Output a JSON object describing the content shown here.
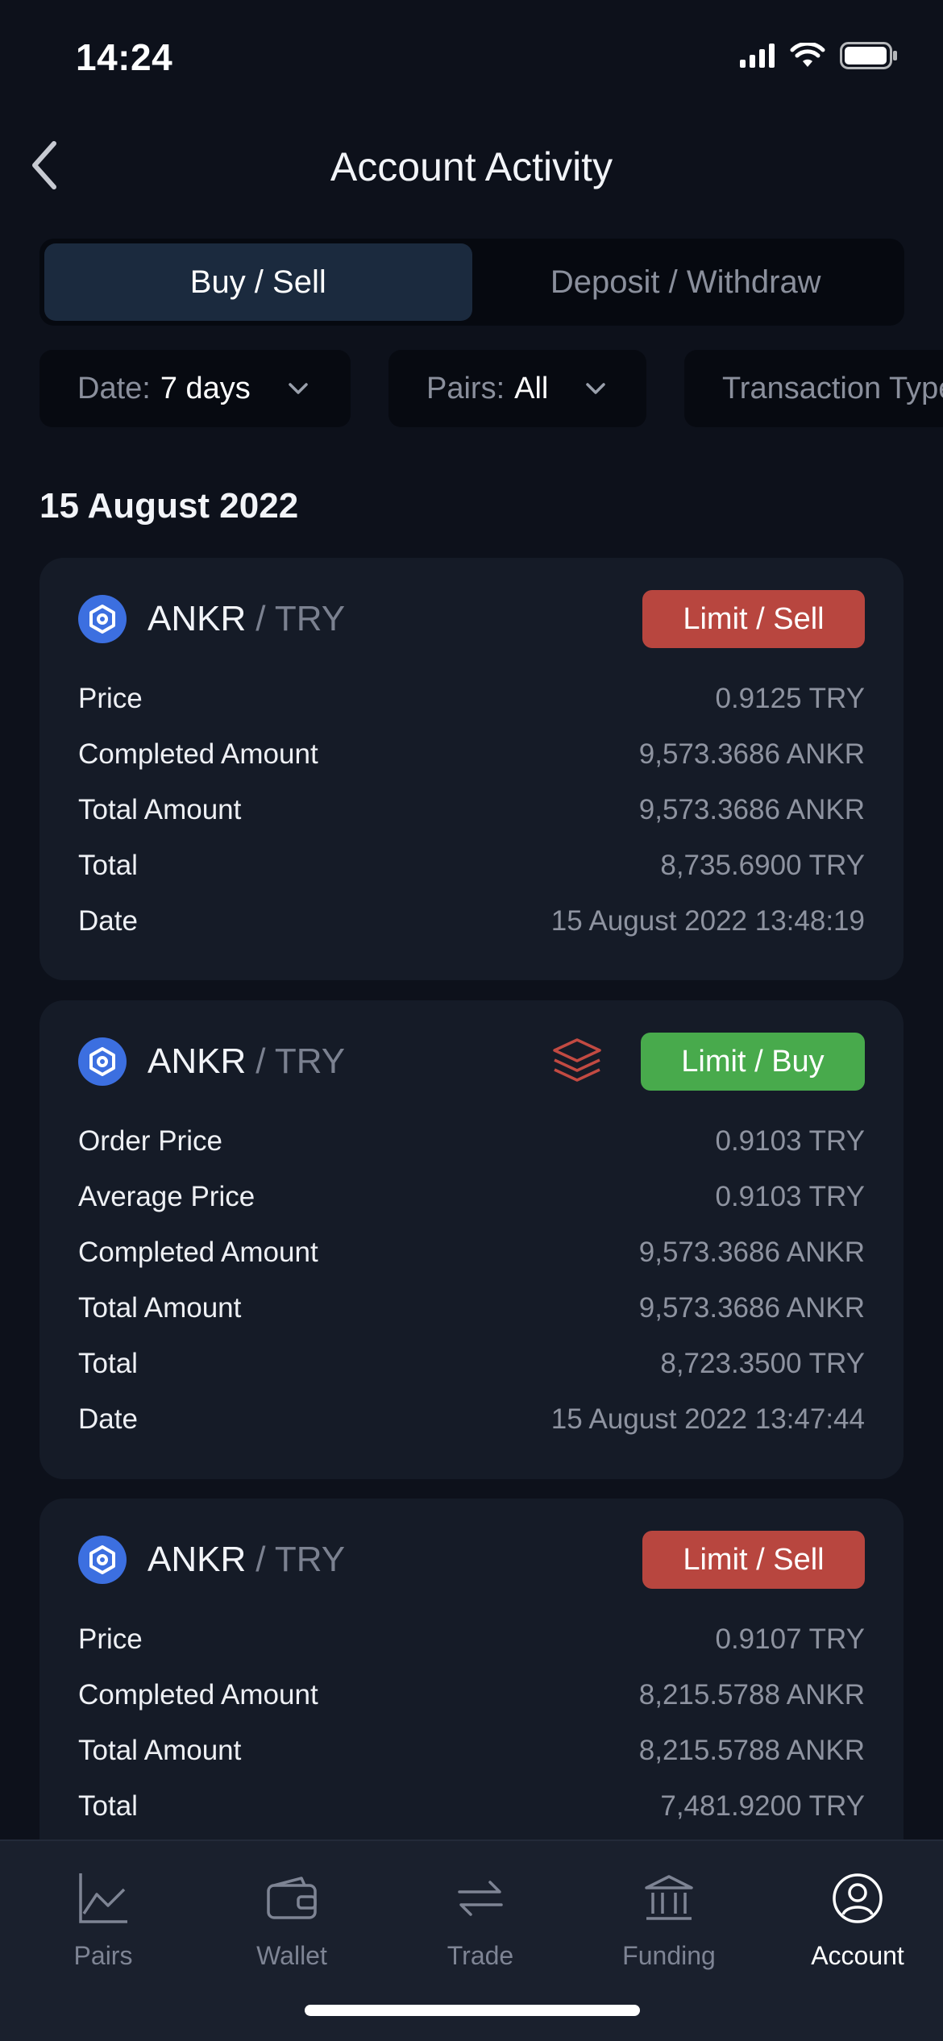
{
  "status_bar": {
    "time": "14:24"
  },
  "header": {
    "title": "Account Activity"
  },
  "segment": {
    "tabs": [
      "Buy / Sell",
      "Deposit / Withdraw"
    ],
    "active": 0
  },
  "filters": [
    {
      "label": "Date:",
      "value": "7 days"
    },
    {
      "label": "Pairs:",
      "value": "All"
    },
    {
      "label": "Transaction Type",
      "value": ""
    }
  ],
  "section": {
    "date": "15 August 2022"
  },
  "orders": [
    {
      "base": "ANKR",
      "quote": "/ TRY",
      "type": "Limit / Sell",
      "multi_fill": false,
      "rows": [
        {
          "k": "Price",
          "v": "0.9125 TRY"
        },
        {
          "k": "Completed Amount",
          "v": "9,573.3686 ANKR"
        },
        {
          "k": "Total Amount",
          "v": "9,573.3686 ANKR"
        },
        {
          "k": "Total",
          "v": "8,735.6900 TRY"
        },
        {
          "k": "Date",
          "v": "15 August 2022 13:48:19"
        }
      ]
    },
    {
      "base": "ANKR",
      "quote": "/ TRY",
      "type": "Limit / Buy",
      "multi_fill": true,
      "rows": [
        {
          "k": "Order Price",
          "v": "0.9103 TRY"
        },
        {
          "k": "Average Price",
          "v": "0.9103 TRY"
        },
        {
          "k": "Completed Amount",
          "v": "9,573.3686 ANKR"
        },
        {
          "k": "Total Amount",
          "v": "9,573.3686 ANKR"
        },
        {
          "k": "Total",
          "v": "8,723.3500 TRY"
        },
        {
          "k": "Date",
          "v": "15 August 2022 13:47:44"
        }
      ]
    },
    {
      "base": "ANKR",
      "quote": "/ TRY",
      "type": "Limit / Sell",
      "multi_fill": false,
      "rows": [
        {
          "k": "Price",
          "v": "0.9107 TRY"
        },
        {
          "k": "Completed Amount",
          "v": "8,215.5788 ANKR"
        },
        {
          "k": "Total Amount",
          "v": "8,215.5788 ANKR"
        },
        {
          "k": "Total",
          "v": "7,481.9200 TRY"
        }
      ]
    }
  ],
  "tab_bar": [
    {
      "label": "Pairs",
      "icon": "chart-line-icon"
    },
    {
      "label": "Wallet",
      "icon": "wallet-icon"
    },
    {
      "label": "Trade",
      "icon": "swap-arrows-icon"
    },
    {
      "label": "Funding",
      "icon": "bank-icon"
    },
    {
      "label": "Account",
      "icon": "user-circle-icon",
      "active": true
    }
  ],
  "colors": {
    "background": "#0d111b",
    "card": "#151b27",
    "sell": "#b8463f",
    "buy": "#48aa4c",
    "coin": "#3c6fe0"
  }
}
